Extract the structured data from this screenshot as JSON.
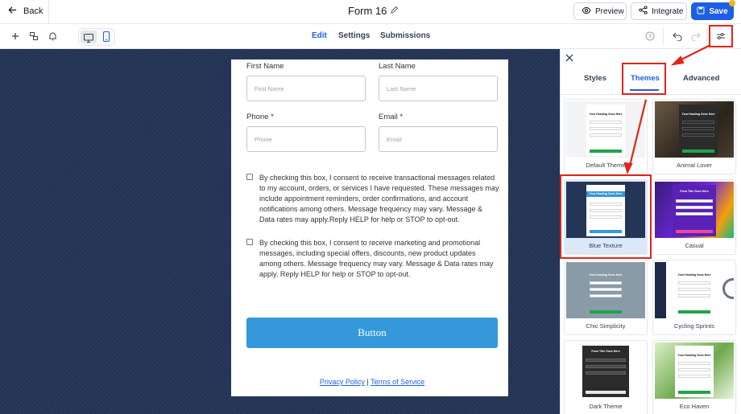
{
  "header": {
    "back_label": "Back",
    "form_title": "Form 16",
    "preview_label": "Preview",
    "integrate_label": "Integrate",
    "save_label": "Save"
  },
  "toolbar": {
    "tabs": [
      {
        "label": "Edit",
        "active": true
      },
      {
        "label": "Settings",
        "active": false
      },
      {
        "label": "Submissions",
        "active": false
      }
    ]
  },
  "form": {
    "first_name_label": "First Name",
    "first_name_placeholder": "First Name",
    "last_name_label": "Last Name",
    "last_name_placeholder": "Last Name",
    "phone_label": "Phone",
    "phone_placeholder": "Phone",
    "email_label": "Email",
    "email_placeholder": "Email",
    "required_mark": "*",
    "consent_1": "By checking this box, I consent to receive transactional messages related to my account, orders, or services I have requested. These messages may include appointment reminders, order confirmations, and account notifications among others. Message frequency may vary. Message & Data rates may apply.Reply HELP for help or STOP to opt-out.",
    "consent_2": "By checking this box, I consent to receive marketing and promotional messages, including special offers, discounts, new product updates among others. Message frequency may vary. Message & Data rates may apply. Reply HELP for help or STOP to opt-out.",
    "button_label": "Button",
    "privacy_link": "Privacy Policy",
    "separator": " | ",
    "terms_link": "Terms of Service"
  },
  "panel": {
    "tabs": [
      {
        "label": "Styles",
        "active": false
      },
      {
        "label": "Themes",
        "active": true
      },
      {
        "label": "Advanced",
        "active": false
      }
    ],
    "themes": [
      {
        "name": "Default Theme",
        "bg": "#f3f4f6",
        "accent": "#22a34a"
      },
      {
        "name": "Animal Lover",
        "bg": "#3a3128",
        "accent": "#22a34a"
      },
      {
        "name": "Blue Texture",
        "bg": "#243557",
        "accent": "#3498db",
        "selected": true
      },
      {
        "name": "Casual",
        "bg": "#6d28d9",
        "accent": "#ec4899"
      },
      {
        "name": "Chic Simplicity",
        "bg": "#8a9ba8",
        "accent": "#22a34a"
      },
      {
        "name": "Cycling Sprints",
        "bg": "#1e2a4a",
        "accent": "#22a34a"
      },
      {
        "name": "Dark Theme",
        "bg": "#ffffff",
        "accent": "#374151"
      },
      {
        "name": "Eco Haven",
        "bg": "#6fa84d",
        "accent": "#22a34a"
      }
    ],
    "thumb_heading": "Your Heading Goes Here",
    "thumb_title": "Form Title Goes Here"
  },
  "colors": {
    "brand_blue": "#1d5fe4",
    "annotation_red": "#e1241b",
    "canvas_bg": "#243557",
    "form_button": "#3498db"
  }
}
